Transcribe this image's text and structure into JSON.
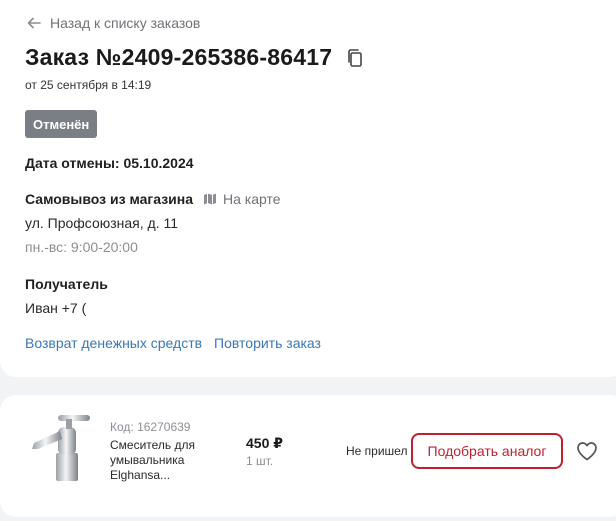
{
  "header": {
    "back_label": "Назад к списку заказов",
    "order_title": "Заказ №2409-265386-86417",
    "order_date": "от 25 сентября в 14:19"
  },
  "status": {
    "badge": "Отменён",
    "badge_color": "#7a7f86"
  },
  "cancel_date": "Дата отмены: 05.10.2024",
  "pickup": {
    "label": "Самовывоз из магазина",
    "map_link": "На карте",
    "address": "ул. Профсоюзная, д. 11",
    "hours": "пн.-вс: 9:00-20:00"
  },
  "recipient": {
    "label": "Получатель",
    "value": "Иван  +7 ("
  },
  "actions": {
    "refund": "Возврат денежных средств",
    "repeat": "Повторить заказ"
  },
  "item": {
    "code": "Код: 16270639",
    "name": "Смеситель для умывальника Elghansa...",
    "price": "450 ₽",
    "qty": "1 шт.",
    "status": "Не пришел",
    "analog_button": "Подобрать аналог",
    "accent_color": "#c21f2e"
  },
  "icons": {
    "back": "arrow-left-icon",
    "copy": "copy-icon",
    "map": "map-icon",
    "favorite": "heart-icon"
  }
}
